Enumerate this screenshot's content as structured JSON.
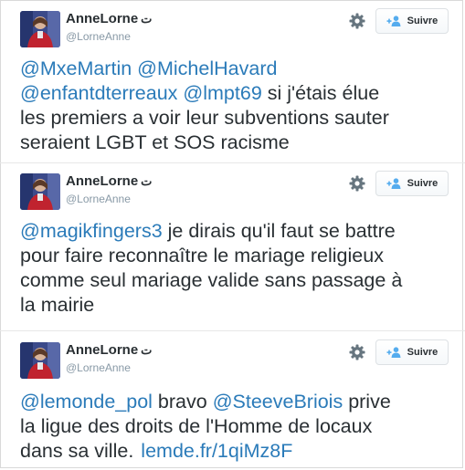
{
  "tweets": [
    {
      "name": "AnneLorne",
      "verified_mark": "ت",
      "handle": "@LorneAnne",
      "follow_label": "Suivre",
      "lines": [
        [
          {
            "t": "@MxeMartin",
            "m": true
          },
          {
            "t": " ",
            "m": false
          },
          {
            "t": "@MichelHavard",
            "m": true
          }
        ],
        [
          {
            "t": "@enfantdterreaux",
            "m": true
          },
          {
            "t": " ",
            "m": false
          },
          {
            "t": "@lmpt69",
            "m": true
          },
          {
            "t": " si j'étais élue",
            "m": false
          }
        ],
        [
          {
            "t": "les premiers a voir leur subventions sauter",
            "m": false
          }
        ],
        [
          {
            "t": "seraient LGBT et SOS racisme",
            "m": false
          }
        ]
      ]
    },
    {
      "name": "AnneLorne",
      "verified_mark": "ت",
      "handle": "@LorneAnne",
      "follow_label": "Suivre",
      "lines": [
        [
          {
            "t": "@magikfingers3",
            "m": true
          },
          {
            "t": " je dirais qu'il faut se battre",
            "m": false
          }
        ],
        [
          {
            "t": "pour faire reconnaître le mariage religieux",
            "m": false
          }
        ],
        [
          {
            "t": "comme seul mariage valide sans passage à",
            "m": false
          }
        ],
        [
          {
            "t": "la mairie",
            "m": false
          }
        ]
      ]
    },
    {
      "name": "AnneLorne",
      "verified_mark": "ت",
      "handle": "@LorneAnne",
      "follow_label": "Suivre",
      "lines": [
        [
          {
            "t": "@lemonde_pol",
            "m": true
          },
          {
            "t": " bravo ",
            "m": false
          },
          {
            "t": "@SteeveBriois",
            "m": true
          },
          {
            "t": " prive",
            "m": false
          }
        ],
        [
          {
            "t": "la ligue des droits de l'Homme de locaux",
            "m": false
          }
        ],
        [
          {
            "t": "dans sa ville.",
            "m": false
          },
          {
            "t": "lemde.fr/1qiMz8F",
            "m": true,
            "link": true
          }
        ]
      ]
    }
  ],
  "icons": {
    "gear": "gear-icon",
    "follow": "add-user-icon"
  },
  "colors": {
    "link": "#2b7bb9",
    "text": "#292f33",
    "handle": "#8899a6",
    "follow_icon": "#55acee"
  }
}
